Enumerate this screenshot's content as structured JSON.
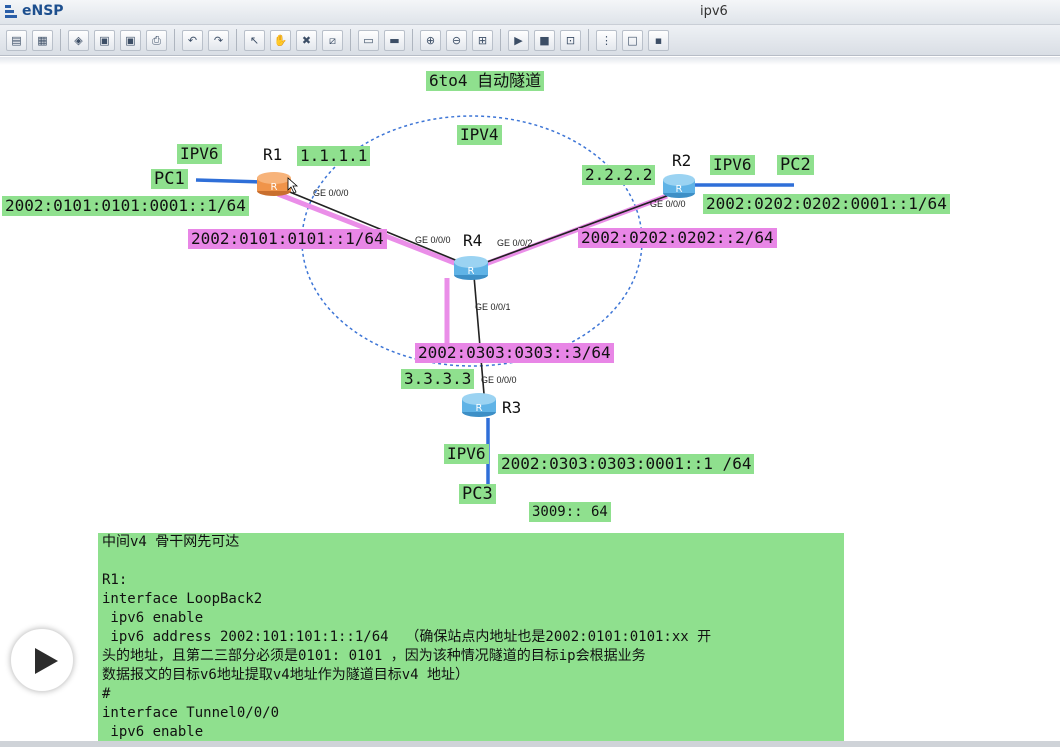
{
  "window": {
    "app_name": "eNSP",
    "title": "ipv6"
  },
  "toolbar": {
    "buttons": [
      {
        "name": "new-topology-icon",
        "glyph": "▤"
      },
      {
        "name": "new-example-icon",
        "glyph": "▦"
      },
      {
        "name": "open-icon",
        "glyph": "◈"
      },
      {
        "name": "save-icon",
        "glyph": "▣"
      },
      {
        "name": "save-as-icon",
        "glyph": "▣"
      },
      {
        "name": "print-icon",
        "glyph": "⎙"
      },
      {
        "name": "undo-icon",
        "glyph": "↶"
      },
      {
        "name": "redo-icon",
        "glyph": "↷"
      },
      {
        "name": "select-icon",
        "glyph": "↖"
      },
      {
        "name": "drag-icon",
        "glyph": "✋"
      },
      {
        "name": "delete-icon",
        "glyph": "✖"
      },
      {
        "name": "delete-link-icon",
        "glyph": "⧄"
      },
      {
        "name": "text-icon",
        "glyph": "▭"
      },
      {
        "name": "palette-icon",
        "glyph": "▬"
      },
      {
        "name": "zoom-in-icon",
        "glyph": "⊕"
      },
      {
        "name": "zoom-out-icon",
        "glyph": "⊖"
      },
      {
        "name": "fit-icon",
        "glyph": "⊞"
      },
      {
        "name": "start-device-icon",
        "glyph": "▶"
      },
      {
        "name": "stop-device-icon",
        "glyph": "■"
      },
      {
        "name": "capture-icon",
        "glyph": "⊡"
      },
      {
        "name": "topology-icon",
        "glyph": "⋮"
      },
      {
        "name": "maximize-icon",
        "glyph": "□"
      },
      {
        "name": "cli-icon",
        "glyph": "▪"
      }
    ]
  },
  "topology": {
    "title": "6to4 自动隧道",
    "ipv4_label": "IPV4",
    "colors": {
      "label_green": "#8fe08e",
      "label_pink": "#e886e6",
      "tunnel_pink": "#ea8ee8",
      "ipv6_link_blue": "#2f6fd8",
      "ellipse_blue": "#3d75d6",
      "router_blue": "#5fb3e6",
      "router_orange": "#f0944a"
    },
    "routers": {
      "r1": "R1",
      "r2": "R2",
      "r3": "R3",
      "r4": "R4"
    },
    "pcs": {
      "pc1": "PC1",
      "pc2": "PC2",
      "pc3": "PC3"
    },
    "ipv6_tags": {
      "pc1": "IPV6",
      "pc2": "IPV6",
      "pc3": "IPV6"
    },
    "ipv4_addresses": {
      "r1": "1.1.1.1",
      "r2": "2.2.2.2",
      "r3": "3.3.3.3"
    },
    "host_addresses": {
      "pc1": "2002:0101:0101:0001::1/64",
      "pc2": "2002:0202:0202:0001::1/64",
      "pc3": "2002:0303:0303:0001::1 /64"
    },
    "tunnel_addresses": {
      "r1": "2002:0101:0101::1/64",
      "r2": "2002:0202:0202::2/64",
      "r3": "2002:0303:0303::3/64"
    },
    "extra_label": "3009:: 64",
    "ports": {
      "r1_g000": "GE 0/0/0",
      "r4_g000": "GE 0/0/0",
      "r4_g002": "GE 0/0/2",
      "r2_g000": "GE 0/0/0",
      "r4_g001": "GE 0/0/1",
      "r3_g000": "GE 0/0/0"
    }
  },
  "note": {
    "lines": [
      "中间v4 骨干网先可达",
      "",
      "R1:",
      "interface LoopBack2",
      " ipv6 enable",
      " ipv6 address 2002:101:101:1::1/64  （确保站点内地址也是2002:0101:0101:xx 开",
      "头的地址，且第二三部分必须是0101: 0101 ，因为该种情况隧道的目标ip会根据业务",
      "数据报文的目标v6地址提取v4地址作为隧道目标v4 地址）",
      "#",
      "interface Tunnel0/0/0",
      " ipv6 enable"
    ]
  },
  "player": {
    "icon": "play-icon"
  }
}
